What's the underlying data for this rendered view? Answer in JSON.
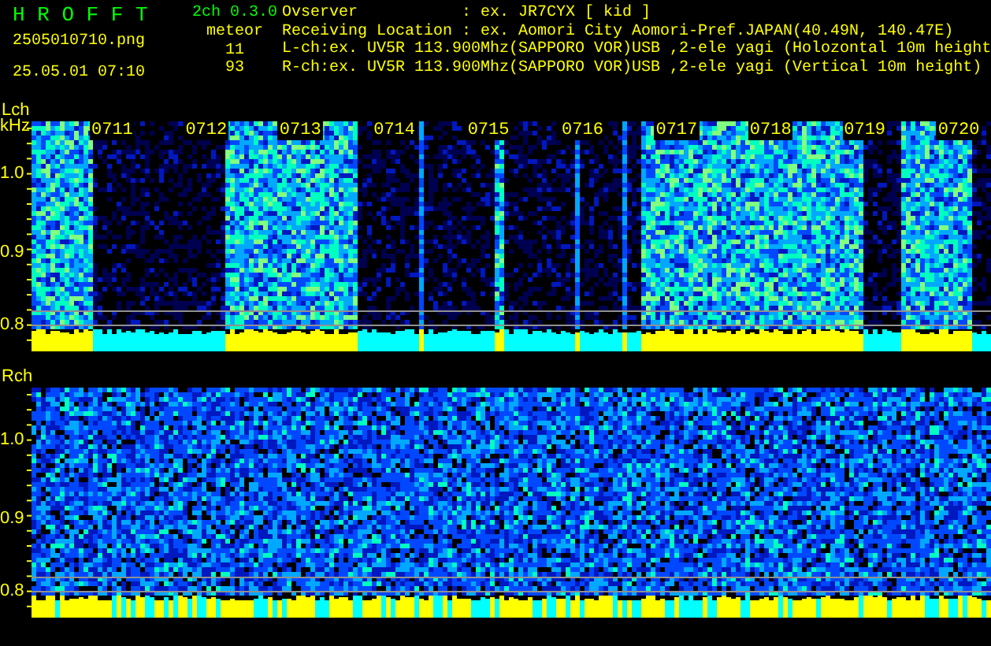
{
  "header": {
    "app_name": "H R O F F T",
    "version": "2ch 0.3.0",
    "file_name": "2505010710.png",
    "timestamp": "25.05.01 07:10",
    "meteor_label": "meteor",
    "counts": [
      "11",
      "93"
    ],
    "info": [
      {
        "kind": "field",
        "label": "Ovserver",
        "value": ": ex. JR7CYX [ kid ]"
      },
      {
        "kind": "field",
        "label": "Receiving Location",
        "value": ": ex. Aomori City Aomori-Pref.JAPAN(40.49N, 140.47E)"
      },
      {
        "kind": "line",
        "value": "L-ch:ex. UV5R 113.900Mhz(SAPPORO VOR)USB ,2-ele yagi (Holozontal 10m height"
      },
      {
        "kind": "line",
        "value": "R-ch:ex. UV5R 113.900Mhz(SAPPORO VOR)USB ,2-ele yagi (Vertical 10m height)"
      }
    ]
  },
  "channels": [
    {
      "kind": "bursts",
      "label": "Lch",
      "unit": "kHz",
      "ticks": [
        "1.0",
        "0.9",
        "0.8"
      ],
      "time_labels": [
        "0711",
        "0712",
        "0713",
        "0714",
        "0715",
        "0716",
        "0717",
        "0718",
        "0719",
        "0720"
      ]
    },
    {
      "kind": "noise",
      "label": "Rch",
      "ticks": [
        "1.0",
        "0.9",
        "0.8"
      ]
    }
  ]
}
